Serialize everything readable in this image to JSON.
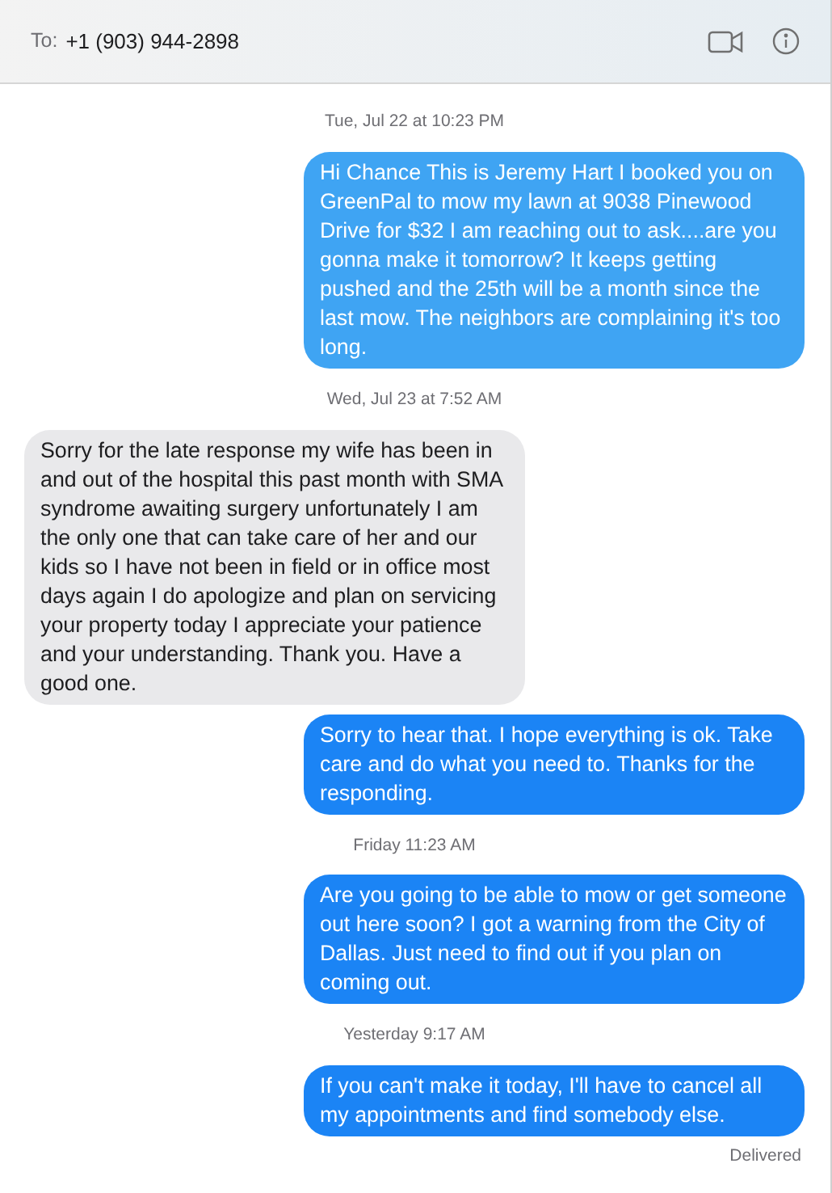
{
  "header": {
    "to_label": "To:",
    "recipient": "+1 (903) 944-2898"
  },
  "messages": [
    {
      "kind": "time",
      "text": "Tue, Jul 22 at 10:23 PM"
    },
    {
      "kind": "sent",
      "color": "#3fa4f3",
      "text": "Hi Chance This is Jeremy Hart I booked you on GreenPal to mow my lawn at 9038 Pinewood Drive for $32 I am reaching out to ask....are you gonna make it tomorrow? It keeps getting pushed and the 25th will be a month since the last mow. The neighbors are complaining it's too long."
    },
    {
      "kind": "time",
      "text": "Wed, Jul 23 at 7:52 AM"
    },
    {
      "kind": "received",
      "color": "#e9e9eb",
      "text": "Sorry for the late response my wife has been in and out of the hospital this past month with SMA syndrome awaiting surgery unfortunately I am the only one that can take care of her and our kids so I have not been in field or in office most days again I do apologize and plan on servicing your property today I appreciate your patience and your understanding. Thank you. Have a good one."
    },
    {
      "kind": "sent",
      "color": "#1b84f5",
      "text": "Sorry to hear that. I hope everything is ok. Take care and do what you need to. Thanks for the responding."
    },
    {
      "kind": "time",
      "text": "Friday 11:23 AM"
    },
    {
      "kind": "sent",
      "color": "#1b84f5",
      "text": "Are you going to be able to mow or get someone out here soon? I got a warning from the City of Dallas. Just need to find out if you plan on coming out."
    },
    {
      "kind": "time",
      "text": "Yesterday 9:17 AM"
    },
    {
      "kind": "sent",
      "color": "#1b84f5",
      "text": "If you can't make it today, I'll have to cancel all my appointments and find somebody else."
    }
  ],
  "status": "Delivered"
}
